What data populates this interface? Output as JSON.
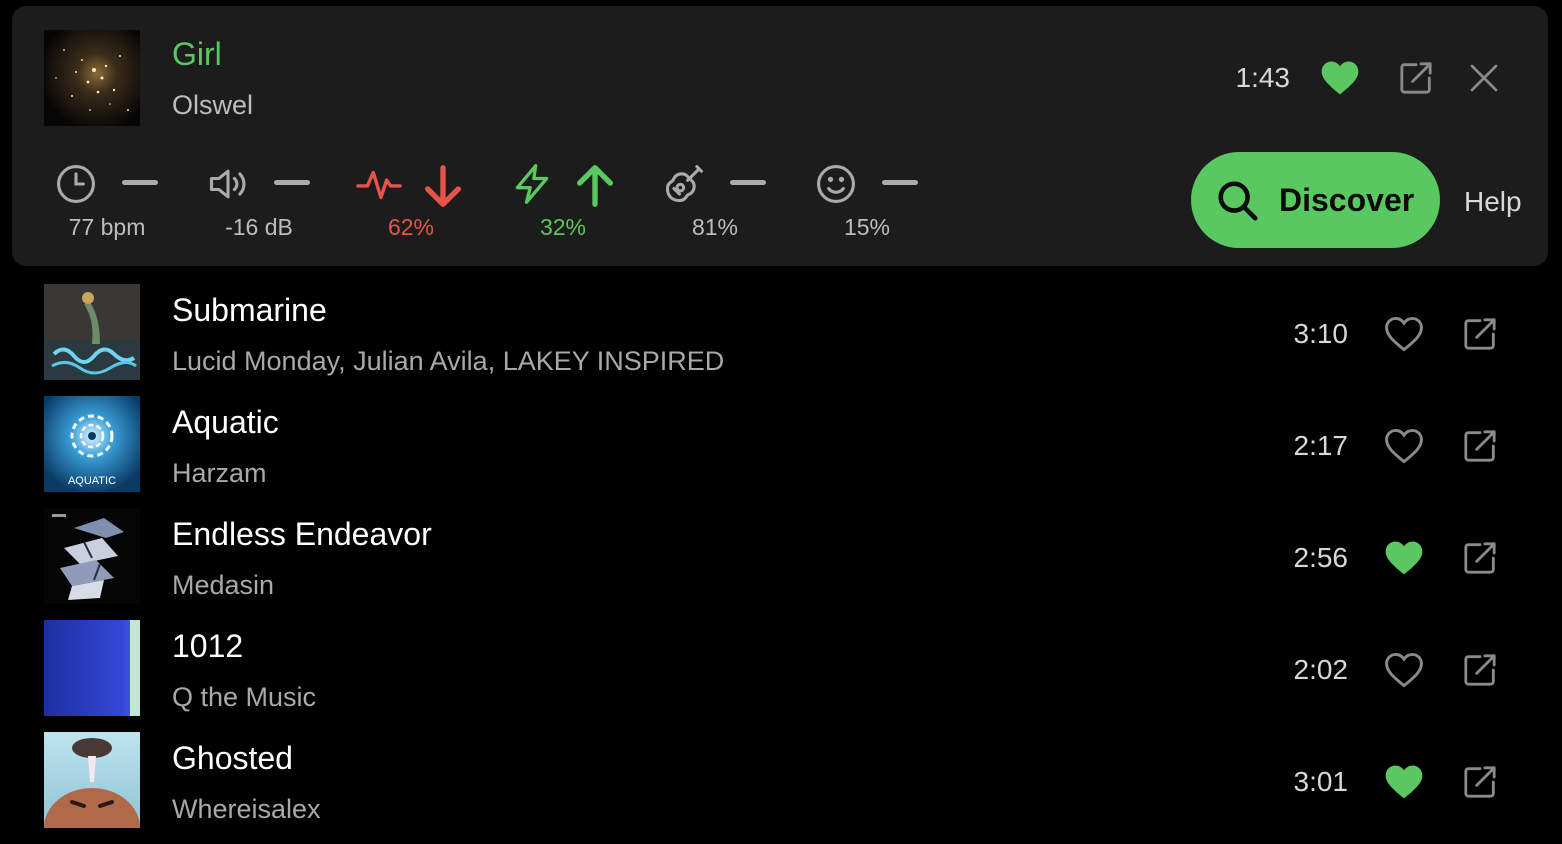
{
  "colors": {
    "accent": "#5ac860",
    "danger": "#e5534b",
    "panel": "#1c1c1c",
    "background": "#000000"
  },
  "now_playing": {
    "title": "Girl",
    "artist": "Olswel",
    "duration": "1:43",
    "liked": true,
    "icons": {
      "like": "heart-filled-icon",
      "open": "external-link-icon",
      "close": "close-icon"
    }
  },
  "stats": [
    {
      "icon": "clock-icon",
      "indicator": "dash",
      "value": "77 bpm"
    },
    {
      "icon": "speaker-icon",
      "indicator": "dash",
      "value": "-16 dB"
    },
    {
      "icon": "heartbeat-icon",
      "indicator": "arrow-down",
      "value": "62%"
    },
    {
      "icon": "lightning-icon",
      "indicator": "arrow-up",
      "value": "32%"
    },
    {
      "icon": "guitar-icon",
      "indicator": "dash",
      "value": "81%"
    },
    {
      "icon": "smiley-icon",
      "indicator": "dash",
      "value": "15%"
    }
  ],
  "actions": {
    "discover_label": "Discover",
    "help_label": "Help"
  },
  "tracks": [
    {
      "title": "Submarine",
      "artist": "Lucid Monday, Julian Avila, LAKEY INSPIRED",
      "duration": "3:10",
      "liked": false
    },
    {
      "title": "Aquatic",
      "artist": "Harzam",
      "duration": "2:17",
      "liked": false,
      "cover_text": "AQUATIC"
    },
    {
      "title": "Endless Endeavor",
      "artist": "Medasin",
      "duration": "2:56",
      "liked": true
    },
    {
      "title": "1012",
      "artist": "Q the Music",
      "duration": "2:02",
      "liked": false
    },
    {
      "title": "Ghosted",
      "artist": "Whereisalex",
      "duration": "3:01",
      "liked": true
    }
  ]
}
